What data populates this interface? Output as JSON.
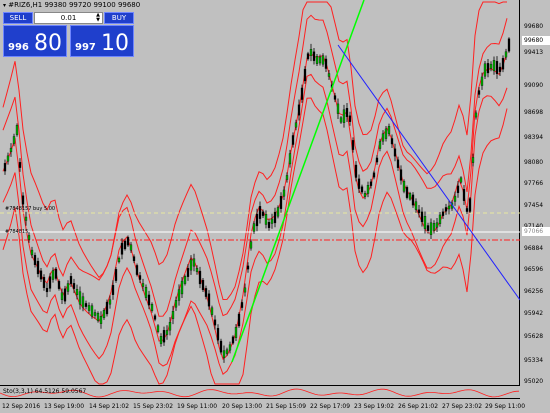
{
  "chart": {
    "title": "#RIZ6,H1  99380 99720 99100 99680",
    "symbol_icon": "triangle-down-icon"
  },
  "trade_panel": {
    "sell_label": "SELL",
    "buy_label": "BUY",
    "lot_value": "0.01",
    "bid_small": "996",
    "bid_big": "80",
    "ask_small": "997",
    "ask_big": "10"
  },
  "price_axis": {
    "labels": [
      "99680",
      "99413",
      "99090",
      "98698",
      "98394",
      "98080",
      "97766",
      "97454",
      "97140",
      "96884",
      "96596",
      "96256",
      "95942",
      "95628",
      "95334",
      "95020"
    ],
    "current_price": "99680",
    "crosshair_price": "97066"
  },
  "lines": {
    "pending_label": "#7848157 buy 5.00",
    "crosshair_label": "#784815"
  },
  "sub_window": {
    "title": "Sto(3,3,1) 64.5126 59.0567"
  },
  "time_axis": {
    "labels": [
      "12 Sep 2016",
      "13 Sep 19:00",
      "14 Sep 21:02",
      "15 Sep 23:02",
      "19 Sep 11:00",
      "20 Sep 13:00",
      "21 Sep 15:09",
      "22 Sep 17:09",
      "23 Sep 19:02",
      "26 Sep 21:02",
      "27 Sep 23:02",
      "29 Sep 11:00"
    ]
  },
  "colors": {
    "background": "#c0c0c0",
    "bull_candle": "#00aa00",
    "bear_candle": "#000000",
    "bands": "#ff2020",
    "trend_green": "#00ff00",
    "trend_blue": "#2020ff",
    "pending_line": "#e8e8a0",
    "panel_blue": "#1f3fcc"
  }
}
